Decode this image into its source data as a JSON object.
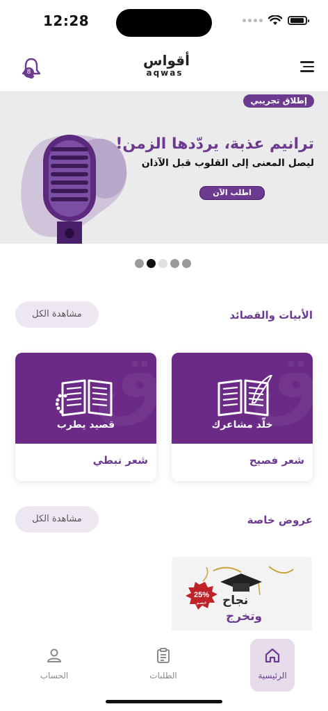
{
  "status_bar": {
    "time": "12:28"
  },
  "header": {
    "notification_count": "8",
    "logo_ar": "أقواس",
    "logo_en": "aqwas",
    "menu_icon": "hamburger-icon",
    "bell_icon": "bell-icon"
  },
  "banner": {
    "tag": "إطلاق تجريبي",
    "title": "ترانيم عذبة، يردّدها الزمن!",
    "subtitle": "ليصل المعنى إلى القلوب قبل الآذان",
    "cta": "اطلب الآن",
    "image_icon": "microphone-icon"
  },
  "carousel": {
    "total": 5,
    "active_index": 1
  },
  "section_poems": {
    "title": "الأبيات والقصائد",
    "view_all": "مشاهدة الكل",
    "cards": [
      {
        "caption": "خلّد مشاعرك",
        "name": "شعر فصيح",
        "icon": "open-book-quill-icon"
      },
      {
        "caption": "قصيد يطرب",
        "name": "شعر نبطي",
        "icon": "open-book-prayer-beads-icon"
      }
    ]
  },
  "section_offers": {
    "title": "عروض خاصة",
    "view_all": "مشاهدة الكل",
    "offer": {
      "line1": "نجاح",
      "line2": "وتخرج",
      "badge_percent": "25%",
      "badge_label": "خصم"
    }
  },
  "bottom_nav": {
    "items": [
      {
        "label": "الحساب",
        "icon": "person-icon"
      },
      {
        "label": "الطلبات",
        "icon": "clipboard-icon"
      },
      {
        "label": "الرئيسية",
        "icon": "home-icon"
      }
    ],
    "active": "الرئيسية"
  },
  "colors": {
    "brand": "#6c3a8f",
    "card_bg": "#6a2a86",
    "banner_bg": "#ebebeb"
  }
}
